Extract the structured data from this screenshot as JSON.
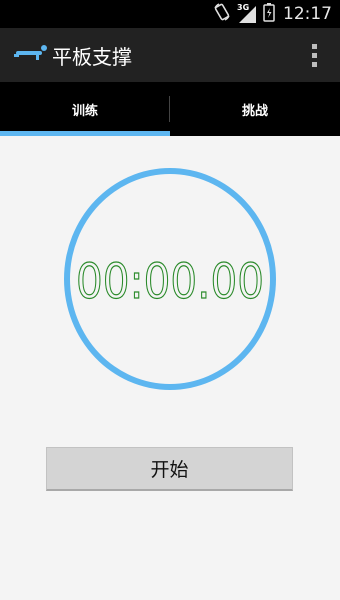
{
  "status_bar": {
    "time": "12:17",
    "network_label": "3G",
    "icons": [
      "rotate-icon",
      "signal-3g-icon",
      "battery-icon"
    ]
  },
  "action_bar": {
    "title": "平板支撑",
    "app_icon": "plank-icon",
    "overflow_icon": "overflow-menu-icon"
  },
  "tabs": [
    {
      "label": "训练",
      "selected": true
    },
    {
      "label": "挑战",
      "selected": false
    }
  ],
  "timer": {
    "display": "00:00.00"
  },
  "start_button": {
    "label": "开始"
  },
  "colors": {
    "accent": "#5db6f0",
    "timer_digits": "#2a8a2a",
    "background": "#f4f4f4",
    "action_bar": "#222222",
    "tab_bar": "#000000"
  }
}
